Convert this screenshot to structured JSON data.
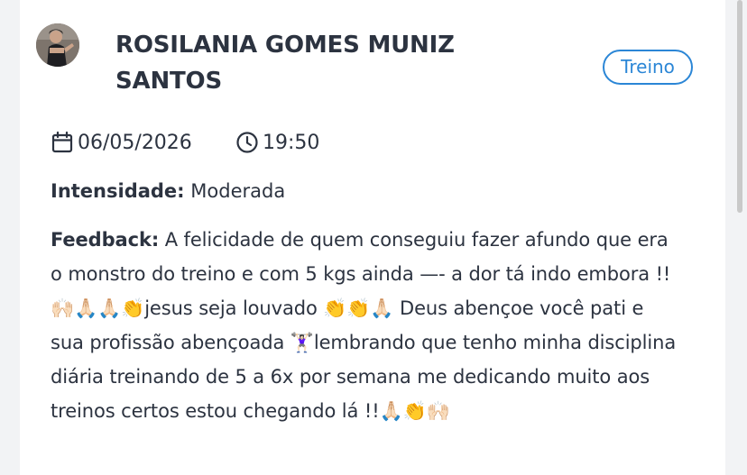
{
  "entry": {
    "user_name": "ROSILANIA GOMES MUNIZ SANTOS",
    "type_badge": "Treino",
    "date": "06/05/2026",
    "time": "19:50",
    "intensity_label": "Intensidade:",
    "intensity_value": "Moderada",
    "feedback_label": "Feedback:",
    "feedback_text": "A felicidade de quem conseguiu fazer afundo que era o monstro do treino e com 5 kgs ainda —- a dor tá indo embora !!🙌🏻🙏🏻🙏🏻👏jesus seja louvado 👏👏🙏🏻 Deus abençoe você pati e sua profissão abençoada 🏋🏻‍♀️lembrando que tenho minha disciplina diária treinando de 5 a 6x por semana me dedicando muito aos treinos certos estou chegando lá !!🙏🏻👏🙌🏻"
  },
  "icons": {
    "date": "calendar-icon",
    "time": "clock-icon"
  },
  "colors": {
    "text": "#2c3340",
    "accent": "#2b86d6",
    "card_bg": "#ffffff",
    "page_bg": "#f2f3f5"
  }
}
